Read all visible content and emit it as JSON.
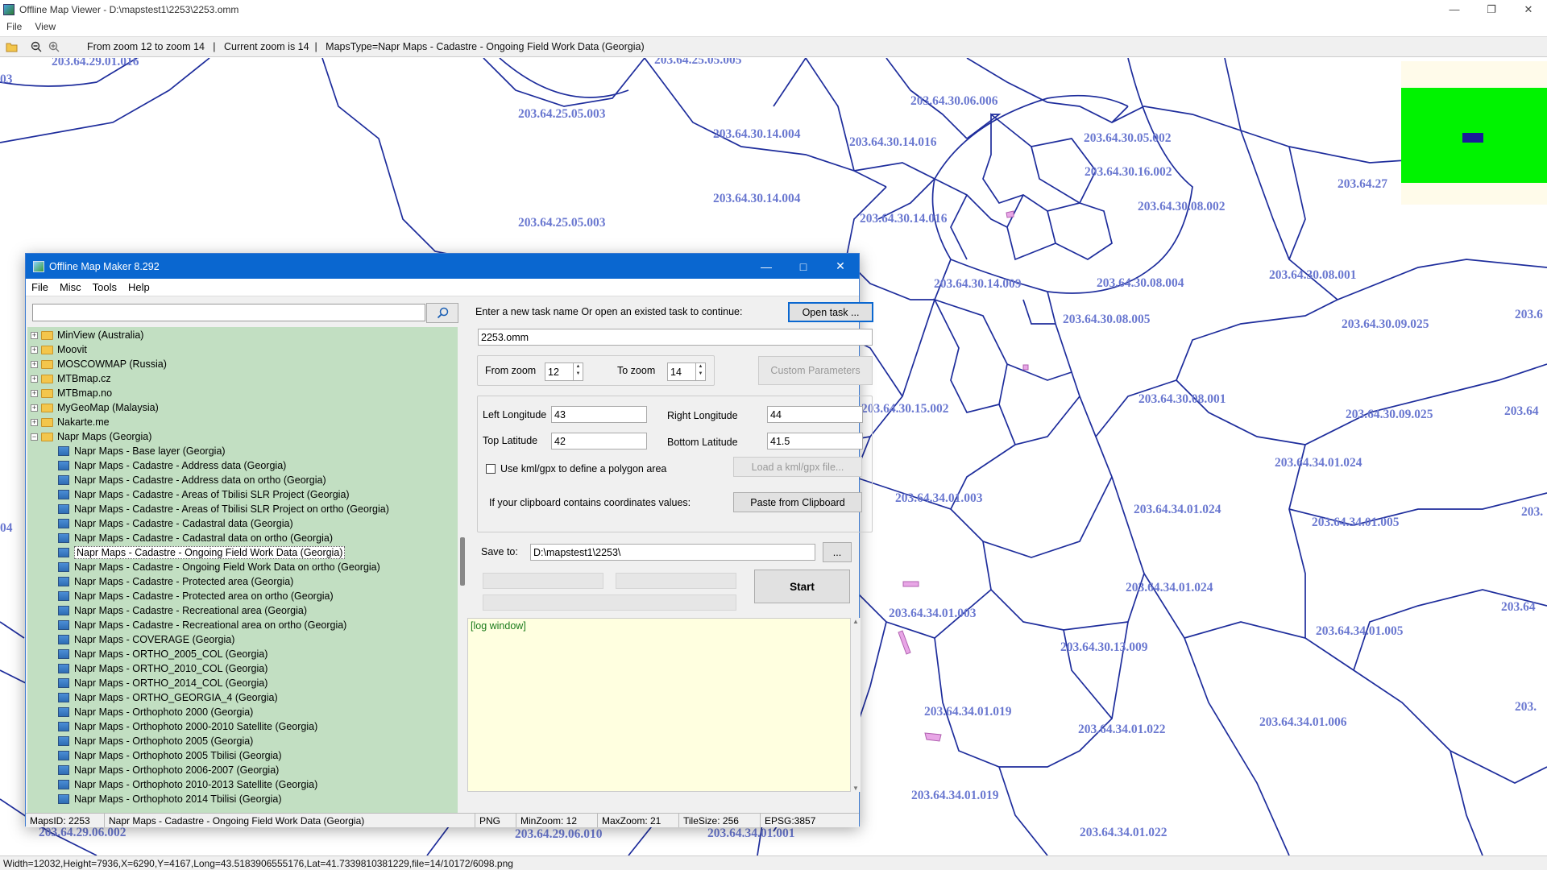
{
  "viewer": {
    "title": "Offline Map Viewer - D:\\mapstest1\\2253\\2253.omm",
    "menu": [
      "File",
      "View"
    ],
    "toolbar_text": "From zoom 12 to zoom 14   |   Current zoom is 14  |   MapsType=Napr Maps - Cadastre - Ongoing Field Work Data (Georgia)",
    "status": "Width=12032,Height=7936,X=6290,Y=4167,Long=43.5183906555176,Lat=41.7339810381229,file=14/10172/6098.png",
    "icons": [
      "folder-open-icon",
      "zoom-out-icon",
      "zoom-in-icon"
    ]
  },
  "map": {
    "line_color": "#1e2d9c",
    "label_color": "#6a78d0",
    "labels": [
      "203.64.29.01.016",
      "203.64.25.05.005",
      "203.64.25.05.003",
      "203.64.30.06.006",
      "203.64.30.14.004",
      "203.64.30.14.016",
      "203.64.30.05.002",
      "203.64.30.16.002",
      "203.64.27",
      "203.64.30.14.004",
      "203.64.25.05.003",
      "203.64.30.14.016",
      "203.64.30.08.002",
      "203.64.30.14.009",
      "203.64.30.08.004",
      "203.64.30.08.001",
      "203.64.30.08.005",
      "203.64.30.09.025",
      "203.6",
      "203.64.30.15.002",
      "203.64.30.08.001",
      "203.64.30.09.025",
      "203.64",
      "203.64.34.01.024",
      "203.64.34.01.003",
      "203.64.34.01.024",
      "203.64.34.01.005",
      "203.",
      "203.64.34.01.024",
      "203.64.34.01.003",
      "203.64.34.01.005",
      "203.64",
      "203.64.30.13.009",
      "203.64.34.01.019",
      "203.64.34.01.022",
      "203.64.34.01.006",
      "203.",
      "203.64.34.01.019",
      "203.64.29.06.002",
      "203.64.29.06.010",
      "203.64.34.01.001",
      "203.64.34.01.022",
      "03",
      "04"
    ]
  },
  "dialog": {
    "title": "Offline Map Maker 8.292",
    "menu": [
      "File",
      "Misc",
      "Tools",
      "Help"
    ],
    "search": {
      "value": "",
      "placeholder": ""
    },
    "tree": [
      {
        "label": "MinView (Australia)",
        "type": "folder",
        "expanded": false
      },
      {
        "label": "Moovit",
        "type": "folder",
        "expanded": false
      },
      {
        "label": "MOSCOWMAP (Russia)",
        "type": "folder",
        "expanded": false
      },
      {
        "label": "MTBmap.cz",
        "type": "folder",
        "expanded": false
      },
      {
        "label": "MTBmap.no",
        "type": "folder",
        "expanded": false
      },
      {
        "label": "MyGeoMap (Malaysia)",
        "type": "folder",
        "expanded": false
      },
      {
        "label": "Nakarte.me",
        "type": "folder",
        "expanded": false
      },
      {
        "label": "Napr Maps (Georgia)",
        "type": "folder",
        "expanded": true
      },
      {
        "label": "Napr Maps - Base layer (Georgia)",
        "type": "map"
      },
      {
        "label": "Napr Maps - Cadastre - Address data (Georgia)",
        "type": "map"
      },
      {
        "label": "Napr Maps - Cadastre - Address data on ortho (Georgia)",
        "type": "map"
      },
      {
        "label": "Napr Maps - Cadastre - Areas of Tbilisi SLR Project (Georgia)",
        "type": "map"
      },
      {
        "label": "Napr Maps - Cadastre - Areas of Tbilisi SLR Project on ortho (Georgia)",
        "type": "map"
      },
      {
        "label": "Napr Maps - Cadastre - Cadastral data (Georgia)",
        "type": "map"
      },
      {
        "label": "Napr Maps - Cadastre - Cadastral data on ortho (Georgia)",
        "type": "map"
      },
      {
        "label": "Napr Maps - Cadastre - Ongoing Field Work Data (Georgia)",
        "type": "map",
        "selected": true
      },
      {
        "label": "Napr Maps - Cadastre - Ongoing Field Work Data on ortho (Georgia)",
        "type": "map"
      },
      {
        "label": "Napr Maps - Cadastre - Protected area (Georgia)",
        "type": "map"
      },
      {
        "label": "Napr Maps - Cadastre - Protected area on ortho (Georgia)",
        "type": "map"
      },
      {
        "label": "Napr Maps - Cadastre - Recreational area (Georgia)",
        "type": "map"
      },
      {
        "label": "Napr Maps - Cadastre - Recreational area on ortho (Georgia)",
        "type": "map"
      },
      {
        "label": "Napr Maps - COVERAGE (Georgia)",
        "type": "map"
      },
      {
        "label": "Napr Maps - ORTHO_2005_COL (Georgia)",
        "type": "map"
      },
      {
        "label": "Napr Maps - ORTHO_2010_COL (Georgia)",
        "type": "map"
      },
      {
        "label": "Napr Maps - ORTHO_2014_COL (Georgia)",
        "type": "map"
      },
      {
        "label": "Napr Maps - ORTHO_GEORGIA_4 (Georgia)",
        "type": "map"
      },
      {
        "label": "Napr Maps - Orthophoto 2000 (Georgia)",
        "type": "map"
      },
      {
        "label": "Napr Maps - Orthophoto 2000-2010 Satellite (Georgia)",
        "type": "map"
      },
      {
        "label": "Napr Maps - Orthophoto 2005 (Georgia)",
        "type": "map"
      },
      {
        "label": "Napr Maps - Orthophoto 2005 Tbilisi (Georgia)",
        "type": "map"
      },
      {
        "label": "Napr Maps - Orthophoto 2006-2007 (Georgia)",
        "type": "map"
      },
      {
        "label": "Napr Maps - Orthophoto 2010-2013 Satellite (Georgia)",
        "type": "map"
      },
      {
        "label": "Napr Maps - Orthophoto 2014 Tbilisi (Georgia)",
        "type": "map"
      }
    ],
    "task_prompt": "Enter a new task name Or open an existed task to continue:",
    "open_task_label": "Open task ...",
    "task_name": "2253.omm",
    "from_zoom_label": "From zoom",
    "from_zoom": "12",
    "to_zoom_label": "To zoom",
    "to_zoom": "14",
    "custom_params_label": "Custom Parameters",
    "left_lon_label": "Left Longitude",
    "left_lon": "43",
    "right_lon_label": "Right Longitude",
    "right_lon": "44",
    "top_lat_label": "Top Latitude",
    "top_lat": "42",
    "bottom_lat_label": "Bottom Latitude",
    "bottom_lat": "41.5",
    "kml_check_label": "Use kml/gpx to define a polygon area",
    "kml_button_label": "Load a kml/gpx file...",
    "clipboard_prompt": "If your clipboard contains coordinates values:",
    "paste_label": "Paste from Clipboard",
    "save_to_label": "Save to:",
    "save_to": "D:\\mapstest1\\2253\\",
    "browse_label": "...",
    "start_label": "Start",
    "log_text": "[log window]",
    "status": {
      "maps_id": "MapsID: 2253",
      "maps_name": "Napr Maps - Cadastre - Ongoing Field Work Data (Georgia)",
      "format": "PNG",
      "min_zoom": "MinZoom: 12",
      "max_zoom": "MaxZoom: 21",
      "tile_size": "TileSize: 256",
      "epsg": "EPSG:3857"
    }
  }
}
